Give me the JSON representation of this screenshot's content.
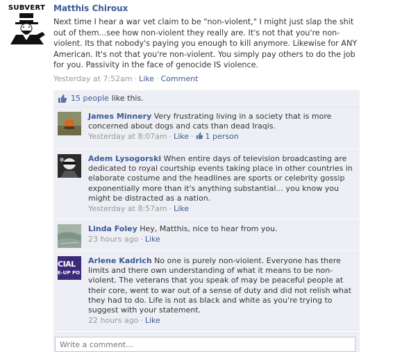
{
  "post": {
    "avatar_text": "SUBVERT",
    "author": "Matthis Chiroux",
    "text": "Next time I hear a war vet claim to be \"non-violent,\" I might just slap the shit out of them...see how non-violent they really are. It's not that you're non-violent. Its that nobody's paying you enough to kill anymore. Likewise for ANY American. It's not that you're non-violent. You simply pay others to do the job for you. Passivity in the face of genocide IS violence.",
    "time": "Yesterday at 7:52am",
    "like_label": "Like",
    "comment_label": "Comment"
  },
  "likes": {
    "count_text": "15 people",
    "suffix": "like this."
  },
  "comments": [
    {
      "name": "James Minnery",
      "text": "Very frustrating living in a society that is more concerned about dogs and cats than dead Iraqis.",
      "time": "Yesterday at 8:07am",
      "like_label": "Like",
      "likes_count": "1 person",
      "avatar": "orange-object-photo"
    },
    {
      "name": "Adem Lysogorski",
      "text": "When entire days of television broadcasting are dedicated to royal courtship events taking place in other countries in elaborate costume and the headlines are sports or celebrity gossip exponentially more than it's anything substantial... you know you might be distracted as a nation.",
      "time": "Yesterday at 8:57am",
      "like_label": "Like",
      "avatar": "dark-figure-photo"
    },
    {
      "name": "Linda Foley",
      "text": "Hey, Matthis, nice to hear from you.",
      "time": "23 hours ago",
      "like_label": "Like",
      "avatar": "landscape-photo"
    },
    {
      "name": "Arlene Kadrich",
      "text": "No one is purely non-violent. Everyone has there limits and there own understanding of what it means to be non-violent. The veterans that you speak of may be peaceful people at their core, went to war out of a sense of duty and did not relish what they had to do. Life is not as black and white as you're trying to suggest with your statement.",
      "time": "22 hours ago",
      "like_label": "Like",
      "avatar": "purple-sign-photo",
      "avatar_text_1": "CIAL",
      "avatar_text_2": "E-UP PO"
    }
  ],
  "composer": {
    "placeholder": "Write a comment..."
  },
  "colors": {
    "link": "#3b5998",
    "ufi_bg": "#edeff4",
    "meta": "#999999"
  }
}
